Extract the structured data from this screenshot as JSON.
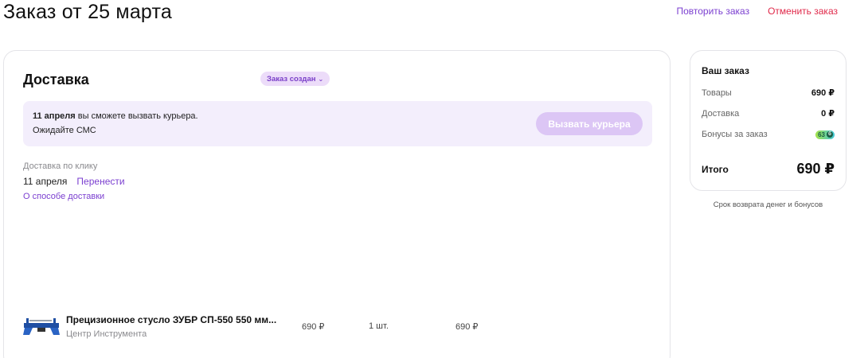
{
  "header": {
    "title": "Заказ от 25 марта",
    "repeat_label": "Повторить заказ",
    "cancel_label": "Отменить заказ"
  },
  "delivery": {
    "title": "Доставка",
    "status": "Заказ создан",
    "courier": {
      "date_bold": "11 апреля",
      "line1_rest": " вы сможете вызвать курьера.",
      "line2": "Ожидайте СМС",
      "button_label": "Вызвать курьера"
    },
    "type_label": "Доставка по клику",
    "date": "11 апреля",
    "reschedule_label": "Перенести",
    "about_label": "О способе доставки"
  },
  "product": {
    "name": "Прецизионное стусло ЗУБР СП-550 550 мм...",
    "seller": "Центр Инструмента",
    "price": "690 ₽",
    "quantity": "1 шт.",
    "total": "690 ₽"
  },
  "summary": {
    "title": "Ваш заказ",
    "goods_label": "Товары",
    "goods_value": "690 ₽",
    "delivery_label": "Доставка",
    "delivery_value": "0 ₽",
    "bonus_label": "Бонусы за заказ",
    "bonus_value": "63",
    "total_label": "Итого",
    "total_value": "690 ₽",
    "refund_link": "Срок возврата денег и бонусов"
  },
  "colors": {
    "accent": "#7b3fd0",
    "danger": "#e0294a",
    "courier_bg": "#f3eefc",
    "courier_button": "#dcc6f5"
  }
}
